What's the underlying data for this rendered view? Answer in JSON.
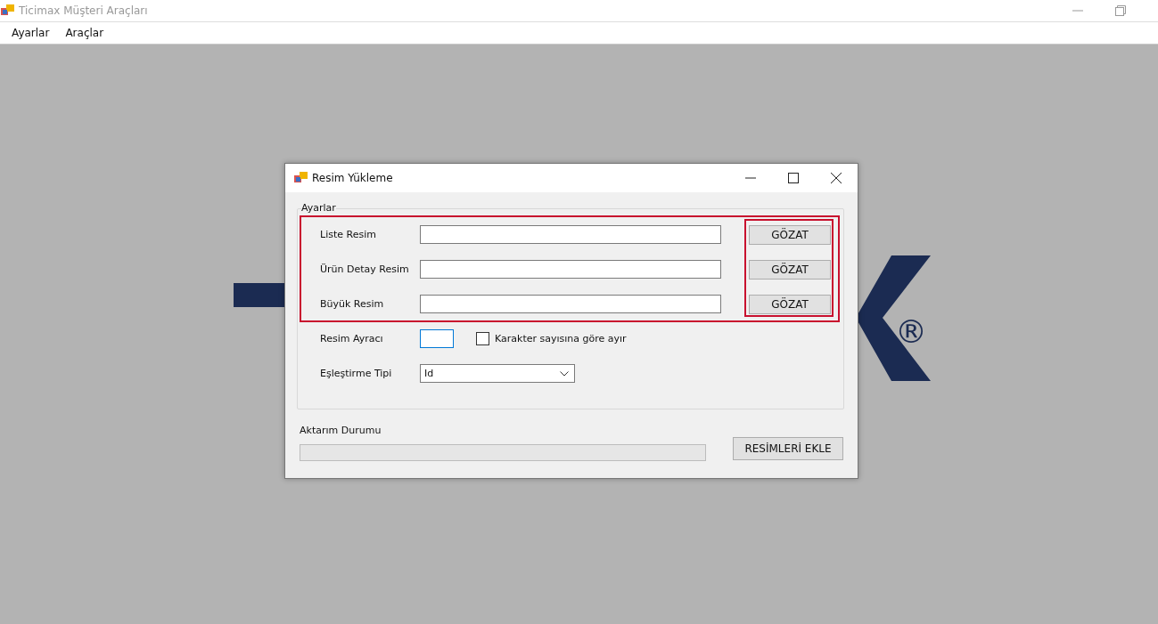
{
  "window": {
    "title": "Ticimax Müşteri Araçları"
  },
  "menu": [
    {
      "label": "Ayarlar"
    },
    {
      "label": "Araçlar"
    }
  ],
  "logo": {
    "mark": "®"
  },
  "dialog": {
    "title": "Resim Yükleme",
    "group": {
      "title": "Ayarlar",
      "file_rows": [
        {
          "label": "Liste Resim",
          "button": "GÖZAT"
        },
        {
          "label": "Ürün Detay Resim",
          "button": "GÖZAT"
        },
        {
          "label": "Büyük Resim",
          "button": "GÖZAT"
        }
      ],
      "separator": {
        "label": "Resim Ayracı",
        "focused": true
      },
      "split_option": {
        "label": "Karakter sayısına göre ayır",
        "checked": false
      },
      "match_type": {
        "label": "Eşleştirme Tipi",
        "value": "Id"
      }
    },
    "progress": {
      "label": "Aktarım Durumu",
      "level": 0
    },
    "action_button": "RESİMLERİ EKLE"
  }
}
